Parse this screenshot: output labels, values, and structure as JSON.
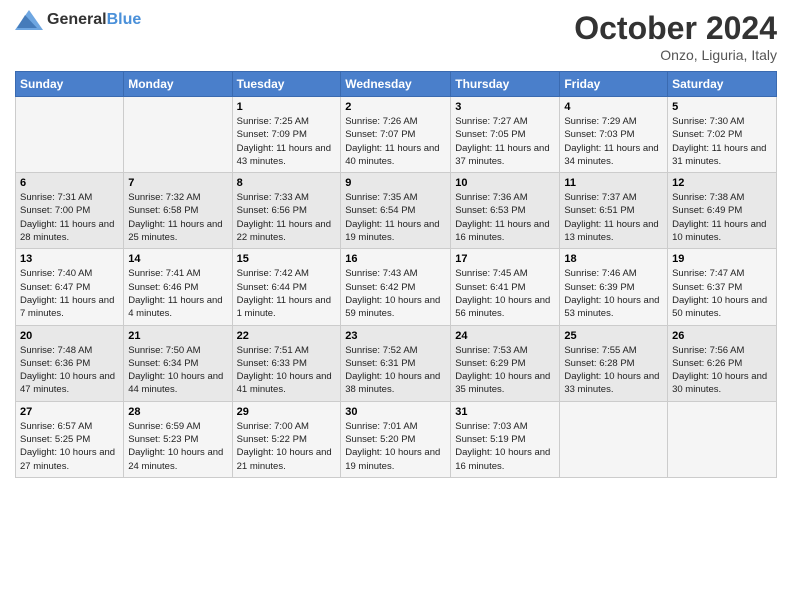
{
  "header": {
    "logo": {
      "general": "General",
      "blue": "Blue"
    },
    "title": "October 2024",
    "subtitle": "Onzo, Liguria, Italy"
  },
  "days_of_week": [
    "Sunday",
    "Monday",
    "Tuesday",
    "Wednesday",
    "Thursday",
    "Friday",
    "Saturday"
  ],
  "weeks": [
    [
      {
        "day": "",
        "sunrise": "",
        "sunset": "",
        "daylight": ""
      },
      {
        "day": "",
        "sunrise": "",
        "sunset": "",
        "daylight": ""
      },
      {
        "day": "1",
        "sunrise": "Sunrise: 7:25 AM",
        "sunset": "Sunset: 7:09 PM",
        "daylight": "Daylight: 11 hours and 43 minutes."
      },
      {
        "day": "2",
        "sunrise": "Sunrise: 7:26 AM",
        "sunset": "Sunset: 7:07 PM",
        "daylight": "Daylight: 11 hours and 40 minutes."
      },
      {
        "day": "3",
        "sunrise": "Sunrise: 7:27 AM",
        "sunset": "Sunset: 7:05 PM",
        "daylight": "Daylight: 11 hours and 37 minutes."
      },
      {
        "day": "4",
        "sunrise": "Sunrise: 7:29 AM",
        "sunset": "Sunset: 7:03 PM",
        "daylight": "Daylight: 11 hours and 34 minutes."
      },
      {
        "day": "5",
        "sunrise": "Sunrise: 7:30 AM",
        "sunset": "Sunset: 7:02 PM",
        "daylight": "Daylight: 11 hours and 31 minutes."
      }
    ],
    [
      {
        "day": "6",
        "sunrise": "Sunrise: 7:31 AM",
        "sunset": "Sunset: 7:00 PM",
        "daylight": "Daylight: 11 hours and 28 minutes."
      },
      {
        "day": "7",
        "sunrise": "Sunrise: 7:32 AM",
        "sunset": "Sunset: 6:58 PM",
        "daylight": "Daylight: 11 hours and 25 minutes."
      },
      {
        "day": "8",
        "sunrise": "Sunrise: 7:33 AM",
        "sunset": "Sunset: 6:56 PM",
        "daylight": "Daylight: 11 hours and 22 minutes."
      },
      {
        "day": "9",
        "sunrise": "Sunrise: 7:35 AM",
        "sunset": "Sunset: 6:54 PM",
        "daylight": "Daylight: 11 hours and 19 minutes."
      },
      {
        "day": "10",
        "sunrise": "Sunrise: 7:36 AM",
        "sunset": "Sunset: 6:53 PM",
        "daylight": "Daylight: 11 hours and 16 minutes."
      },
      {
        "day": "11",
        "sunrise": "Sunrise: 7:37 AM",
        "sunset": "Sunset: 6:51 PM",
        "daylight": "Daylight: 11 hours and 13 minutes."
      },
      {
        "day": "12",
        "sunrise": "Sunrise: 7:38 AM",
        "sunset": "Sunset: 6:49 PM",
        "daylight": "Daylight: 11 hours and 10 minutes."
      }
    ],
    [
      {
        "day": "13",
        "sunrise": "Sunrise: 7:40 AM",
        "sunset": "Sunset: 6:47 PM",
        "daylight": "Daylight: 11 hours and 7 minutes."
      },
      {
        "day": "14",
        "sunrise": "Sunrise: 7:41 AM",
        "sunset": "Sunset: 6:46 PM",
        "daylight": "Daylight: 11 hours and 4 minutes."
      },
      {
        "day": "15",
        "sunrise": "Sunrise: 7:42 AM",
        "sunset": "Sunset: 6:44 PM",
        "daylight": "Daylight: 11 hours and 1 minute."
      },
      {
        "day": "16",
        "sunrise": "Sunrise: 7:43 AM",
        "sunset": "Sunset: 6:42 PM",
        "daylight": "Daylight: 10 hours and 59 minutes."
      },
      {
        "day": "17",
        "sunrise": "Sunrise: 7:45 AM",
        "sunset": "Sunset: 6:41 PM",
        "daylight": "Daylight: 10 hours and 56 minutes."
      },
      {
        "day": "18",
        "sunrise": "Sunrise: 7:46 AM",
        "sunset": "Sunset: 6:39 PM",
        "daylight": "Daylight: 10 hours and 53 minutes."
      },
      {
        "day": "19",
        "sunrise": "Sunrise: 7:47 AM",
        "sunset": "Sunset: 6:37 PM",
        "daylight": "Daylight: 10 hours and 50 minutes."
      }
    ],
    [
      {
        "day": "20",
        "sunrise": "Sunrise: 7:48 AM",
        "sunset": "Sunset: 6:36 PM",
        "daylight": "Daylight: 10 hours and 47 minutes."
      },
      {
        "day": "21",
        "sunrise": "Sunrise: 7:50 AM",
        "sunset": "Sunset: 6:34 PM",
        "daylight": "Daylight: 10 hours and 44 minutes."
      },
      {
        "day": "22",
        "sunrise": "Sunrise: 7:51 AM",
        "sunset": "Sunset: 6:33 PM",
        "daylight": "Daylight: 10 hours and 41 minutes."
      },
      {
        "day": "23",
        "sunrise": "Sunrise: 7:52 AM",
        "sunset": "Sunset: 6:31 PM",
        "daylight": "Daylight: 10 hours and 38 minutes."
      },
      {
        "day": "24",
        "sunrise": "Sunrise: 7:53 AM",
        "sunset": "Sunset: 6:29 PM",
        "daylight": "Daylight: 10 hours and 35 minutes."
      },
      {
        "day": "25",
        "sunrise": "Sunrise: 7:55 AM",
        "sunset": "Sunset: 6:28 PM",
        "daylight": "Daylight: 10 hours and 33 minutes."
      },
      {
        "day": "26",
        "sunrise": "Sunrise: 7:56 AM",
        "sunset": "Sunset: 6:26 PM",
        "daylight": "Daylight: 10 hours and 30 minutes."
      }
    ],
    [
      {
        "day": "27",
        "sunrise": "Sunrise: 6:57 AM",
        "sunset": "Sunset: 5:25 PM",
        "daylight": "Daylight: 10 hours and 27 minutes."
      },
      {
        "day": "28",
        "sunrise": "Sunrise: 6:59 AM",
        "sunset": "Sunset: 5:23 PM",
        "daylight": "Daylight: 10 hours and 24 minutes."
      },
      {
        "day": "29",
        "sunrise": "Sunrise: 7:00 AM",
        "sunset": "Sunset: 5:22 PM",
        "daylight": "Daylight: 10 hours and 21 minutes."
      },
      {
        "day": "30",
        "sunrise": "Sunrise: 7:01 AM",
        "sunset": "Sunset: 5:20 PM",
        "daylight": "Daylight: 10 hours and 19 minutes."
      },
      {
        "day": "31",
        "sunrise": "Sunrise: 7:03 AM",
        "sunset": "Sunset: 5:19 PM",
        "daylight": "Daylight: 10 hours and 16 minutes."
      },
      {
        "day": "",
        "sunrise": "",
        "sunset": "",
        "daylight": ""
      },
      {
        "day": "",
        "sunrise": "",
        "sunset": "",
        "daylight": ""
      }
    ]
  ]
}
